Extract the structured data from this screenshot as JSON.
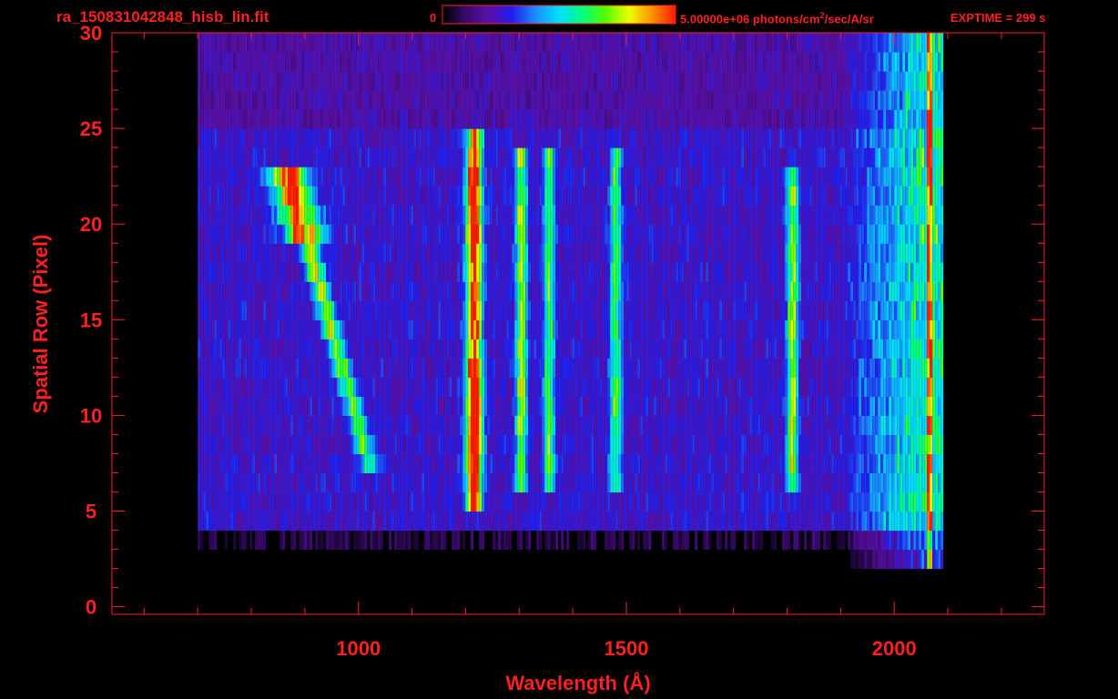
{
  "header": {
    "filename": "ra_150831042848_hisb_lin.fit",
    "colorbar_min": "0",
    "colorbar_max_value": "5.00000e+06",
    "colorbar_max_units_pre": " photons/cm",
    "colorbar_max_units_sup": "2",
    "colorbar_max_units_post": "/sec/A/sr",
    "exptime": "EXPTIME = 299 s"
  },
  "colors": {
    "axis": "#ff2020",
    "background": "#000000",
    "colormap": [
      "#000000",
      "#3a0a6e",
      "#5a10a8",
      "#2020f0",
      "#1d8cff",
      "#00e0ff",
      "#00ff80",
      "#50ff00",
      "#e8ff00",
      "#ff9000",
      "#ff1a00"
    ]
  },
  "chart_data": {
    "type": "heatmap",
    "title": "ra_150831042848_hisb_lin.fit",
    "xlabel": "Wavelength (Å)",
    "ylabel": "Spatial Row (Pixel)",
    "xlim": [
      540,
      2280
    ],
    "ylim": [
      -0.4,
      30
    ],
    "x_ticks": [
      1000,
      1500,
      2000
    ],
    "y_ticks": [
      0,
      5,
      10,
      15,
      20,
      25,
      30
    ],
    "colorbar_range": [
      0,
      5000000
    ],
    "colorbar_units": "photons/cm^2/sec/A/sr",
    "data_extent": {
      "x": [
        700,
        2090
      ],
      "y": [
        0,
        30
      ]
    },
    "grid": false,
    "features": [
      {
        "name": "diagonal streak",
        "x_start": 860,
        "x_end": 1020,
        "rows": [
          7,
          23
        ]
      },
      {
        "name": "emission line",
        "x": 1216,
        "rows": [
          5,
          25
        ],
        "level": "high"
      },
      {
        "name": "emission line",
        "x": 1304,
        "rows": [
          6,
          24
        ],
        "level": "medium"
      },
      {
        "name": "emission line",
        "x": 1356,
        "rows": [
          6,
          24
        ],
        "level": "low-medium"
      },
      {
        "name": "emission line",
        "x": 1480,
        "rows": [
          6,
          24
        ],
        "level": "low-medium"
      },
      {
        "name": "emission line",
        "x": 1810,
        "rows": [
          6,
          23
        ],
        "level": "medium"
      },
      {
        "name": "red-edge continuum",
        "x": [
          1920,
          2070
        ],
        "rows": [
          2,
          30
        ],
        "level": "medium-high"
      }
    ]
  }
}
